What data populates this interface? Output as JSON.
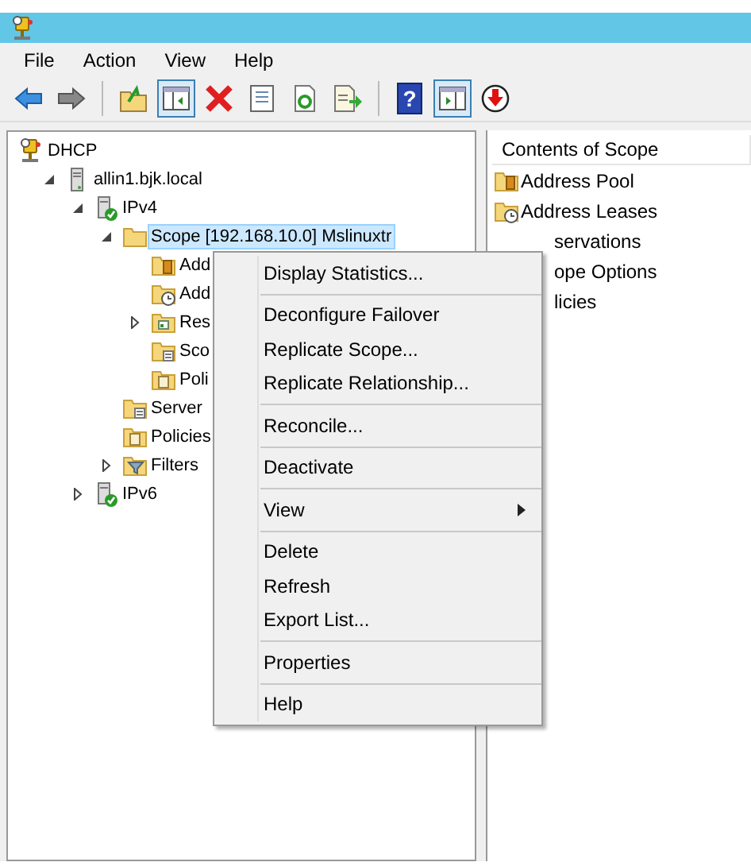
{
  "menubar": [
    {
      "label": "File"
    },
    {
      "label": "Action"
    },
    {
      "label": "View"
    },
    {
      "label": "Help"
    }
  ],
  "toolbar": [
    {
      "kind": "back",
      "pressed": false
    },
    {
      "kind": "forward",
      "pressed": false
    },
    {
      "kind": "separator"
    },
    {
      "kind": "up",
      "pressed": false
    },
    {
      "kind": "tree",
      "pressed": true
    },
    {
      "kind": "delete",
      "pressed": false
    },
    {
      "kind": "properties",
      "pressed": false
    },
    {
      "kind": "refresh",
      "pressed": false
    },
    {
      "kind": "export",
      "pressed": false
    },
    {
      "kind": "separator"
    },
    {
      "kind": "help",
      "glyph": "?",
      "pressed": false
    },
    {
      "kind": "pane",
      "pressed": true
    },
    {
      "kind": "stop",
      "pressed": false
    }
  ],
  "tree": [
    {
      "label": "DHCP",
      "kind": "dhcp",
      "selected": false,
      "children": [
        {
          "label": "allin1.bjk.local",
          "kind": "server",
          "expanded": true,
          "selected": false,
          "children": [
            {
              "label": "IPv4",
              "kind": "server-ok",
              "expanded": true,
              "selected": false,
              "children": [
                {
                  "label": "Scope [192.168.10.0] Mslinuxtr",
                  "kind": "folder",
                  "expanded": true,
                  "selected": true,
                  "children": [
                    {
                      "label": "Add",
                      "kind": "pool",
                      "selected": false
                    },
                    {
                      "label": "Add",
                      "kind": "leases",
                      "selected": false
                    },
                    {
                      "label": "Res",
                      "kind": "reservations",
                      "expanded": false,
                      "selected": false
                    },
                    {
                      "label": "Sco",
                      "kind": "options",
                      "selected": false
                    },
                    {
                      "label": "Poli",
                      "kind": "policies",
                      "selected": false
                    }
                  ]
                },
                {
                  "label": "Server",
                  "kind": "options",
                  "selected": false
                },
                {
                  "label": "Policies",
                  "kind": "policies",
                  "selected": false
                },
                {
                  "label": "Filters",
                  "kind": "filters",
                  "expanded": false,
                  "selected": false
                }
              ]
            },
            {
              "label": "IPv6",
              "kind": "server-ok",
              "expanded": false,
              "selected": false
            }
          ]
        }
      ]
    }
  ],
  "contents": {
    "header": "Contents of Scope",
    "items": [
      {
        "label": "Address Pool",
        "kind": "pool"
      },
      {
        "label": "Address Leases",
        "kind": "leases"
      },
      {
        "label": "servations",
        "kind": "covered"
      },
      {
        "label": "ope Options",
        "kind": "covered"
      },
      {
        "label": "licies",
        "kind": "covered"
      }
    ]
  },
  "context_menu": [
    {
      "kind": "item",
      "label": "Display Statistics...",
      "submenu": false
    },
    {
      "kind": "separator"
    },
    {
      "kind": "item",
      "label": "Deconfigure Failover",
      "submenu": false
    },
    {
      "kind": "item",
      "label": "Replicate Scope...",
      "submenu": false
    },
    {
      "kind": "item",
      "label": "Replicate Relationship...",
      "submenu": false
    },
    {
      "kind": "separator"
    },
    {
      "kind": "item",
      "label": "Reconcile...",
      "submenu": false
    },
    {
      "kind": "separator"
    },
    {
      "kind": "item",
      "label": "Deactivate",
      "submenu": false
    },
    {
      "kind": "separator"
    },
    {
      "kind": "item",
      "label": "View",
      "submenu": true
    },
    {
      "kind": "separator"
    },
    {
      "kind": "item",
      "label": "Delete",
      "submenu": false
    },
    {
      "kind": "item",
      "label": "Refresh",
      "submenu": false
    },
    {
      "kind": "item",
      "label": "Export List...",
      "submenu": false
    },
    {
      "kind": "separator"
    },
    {
      "kind": "item",
      "label": "Properties",
      "submenu": false
    },
    {
      "kind": "separator"
    },
    {
      "kind": "item",
      "label": "Help",
      "submenu": false
    }
  ]
}
